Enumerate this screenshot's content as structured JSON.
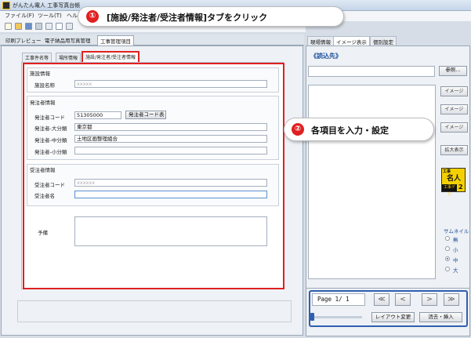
{
  "window": {
    "title": "がんたん電人 工事写真台帳"
  },
  "menu": {
    "items": [
      "ファイル(F)",
      "ツール(T)",
      "ヘル"
    ]
  },
  "main_tabs": [
    "印刷プレビュー",
    "電子納品用写真管理",
    "工事管理項目"
  ],
  "sub_tabs": [
    "工事件名等",
    "場所情報",
    "施設/発注者/受注者情報"
  ],
  "facility": {
    "section_title": "施設情報",
    "name_label": "施設名称",
    "name_value": "xxxxx"
  },
  "orderer": {
    "section_title": "発注者情報",
    "code_label": "発注者コード",
    "code_value": "51305000",
    "code_button": "発注者コード表",
    "major_label": "発注者-大分類",
    "major_value": "東京都",
    "middle_label": "発注者-中分類",
    "middle_value": "土地区画整理組合",
    "minor_label": "発注者-小分類",
    "minor_value": ""
  },
  "contractor": {
    "section_title": "受注者情報",
    "code_label": "受注者コード",
    "code_value": "xxxxxx",
    "name_label": "受注者名",
    "name_value": ""
  },
  "remarks": {
    "label": "予備"
  },
  "callouts": [
    {
      "num": "①",
      "text": "[施設/発注者/受注者情報]タブをクリック"
    },
    {
      "num": "②",
      "text": "各項目を入力・設定"
    }
  ],
  "right_panel": {
    "tabs": [
      "現場情報",
      "イメージ表示",
      "個別設定"
    ],
    "heading": "《読込先》",
    "browse_button": "参照...",
    "image_buttons": [
      "イメージ",
      "イメージ",
      "イメージ"
    ],
    "zoom_button": "拡大表示",
    "badge_text": [
      "工事",
      "名人",
      "工事デジ",
      "2"
    ],
    "thumbnail_label": "サムネイル",
    "thumbnail_options": [
      "無",
      "小",
      "中",
      "大"
    ],
    "thumbnail_selected": "中"
  },
  "bottom": {
    "page_label": "Page 1/ 1",
    "nav": [
      "≪",
      "<",
      ">",
      "≫"
    ],
    "layout_button": "レイアウト変更",
    "delete_insert_button": "消去・挿入"
  },
  "colors": {
    "highlight_red": "#e02020",
    "callout_num_bg": "#e02020",
    "nav_frame_blue": "#2f5fb0"
  }
}
